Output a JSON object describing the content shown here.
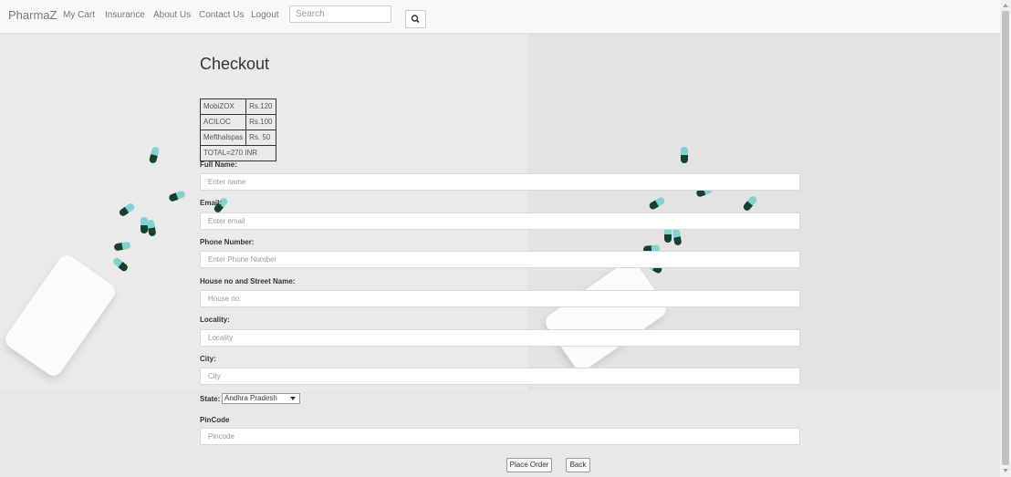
{
  "navbar": {
    "brand": "PharmaZ",
    "links": [
      "My Cart",
      "Insurance",
      "About Us",
      "Contact Us",
      "Logout"
    ],
    "search_placeholder": "Search",
    "search_icon": "search-icon"
  },
  "main": {
    "title": "Checkout",
    "cart": [
      {
        "item": "MobiZOX",
        "price": "Rs.120"
      },
      {
        "item": "ACILOC",
        "price": "Rs.100"
      },
      {
        "item": "Mefthalspas",
        "price": "Rs. 50"
      }
    ],
    "total": "TOTAL=270 INR",
    "form": {
      "full_name_label": "Full Name:",
      "full_name_placeholder": "Enter name",
      "email_label": "Email:",
      "email_placeholder": "Enter email",
      "phone_label": "Phone Number:",
      "phone_placeholder": "Enter Phone Number",
      "house_label": "House no and Street Name:",
      "house_placeholder": "House no.",
      "locality_label": "Locality:",
      "locality_placeholder": "Locality",
      "city_label": "City:",
      "city_placeholder": "City",
      "state_label": "State:",
      "state_value": "Andhra Pradesh",
      "pincode_label": "PinCode",
      "pincode_placeholder": "Pincode"
    },
    "buttons": {
      "place_order": "Place Order",
      "back": "Back"
    }
  }
}
